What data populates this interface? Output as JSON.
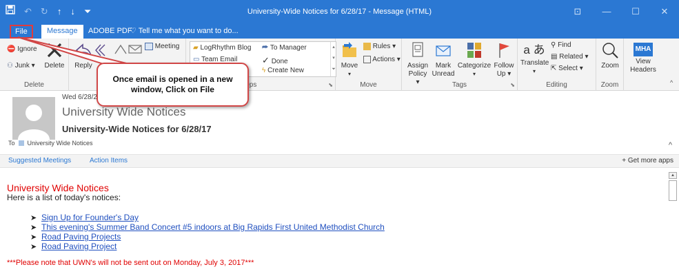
{
  "window": {
    "title": "University-Wide Notices for 6/28/17 - Message (HTML)",
    "qat_icons": [
      "save-icon",
      "undo-icon",
      "redo-icon",
      "up-icon",
      "down-icon",
      "customize-icon"
    ]
  },
  "tabs": {
    "file": "File",
    "message": "Message",
    "adobe": "ADOBE PDF",
    "tell": "Tell me what you want to do..."
  },
  "ribbon": {
    "delete_group": {
      "ignore": "Ignore",
      "delete": "Delete",
      "junk": "Junk",
      "label": "Delete"
    },
    "respond_group": {
      "reply": "Reply",
      "reply_all_partial": "R",
      "meeting": "Meeting"
    },
    "quick_steps": {
      "items": [
        "LogRhythm Blog",
        "Team Email",
        "To Manager",
        "Done",
        "Create New"
      ],
      "label": "ck Steps"
    },
    "move_group": {
      "move": "Move",
      "rules": "Rules",
      "actions": "Actions",
      "label": "Move"
    },
    "tags_group": {
      "assign_line1": "Assign",
      "assign_line2": "Policy",
      "mark_line1": "Mark",
      "mark_line2": "Unread",
      "categorize": "Categorize",
      "follow_line1": "Follow",
      "follow_line2": "Up",
      "label": "Tags"
    },
    "editing_group": {
      "translate": "Translate",
      "find": "Find",
      "related": "Related",
      "select": "Select",
      "label": "Editing"
    },
    "zoom_group": {
      "zoom": "Zoom",
      "label": "Zoom"
    },
    "headers_group": {
      "badge": "MHA",
      "view": "View",
      "headers": "Headers"
    }
  },
  "callout": {
    "text": "Once email is opened in a new window, Click on File"
  },
  "header": {
    "date": "Wed 6/28/20",
    "from": "University Wide Notices",
    "subject": "University-Wide Notices for 6/28/17",
    "to_label": "To",
    "to_value": "University Wide Notices"
  },
  "addins": {
    "suggested": "Suggested Meetings",
    "actions": "Action Items",
    "more_apps": "Get more apps"
  },
  "body": {
    "title": "University Wide Notices",
    "intro": "Here is a list of today's notices:",
    "items": [
      "Sign Up for Founder's Day",
      "This evening's Summer Band Concert #5 indoors at Big Rapids First United Methodist Church",
      "Road Paving Projects",
      "Road Paving Project"
    ],
    "note": "***Please note that UWN's will not be sent out on Monday, July 3, 2017***"
  },
  "colors": {
    "accent": "#2b78d3",
    "callout_border": "#d14646",
    "notice_red": "#e00000",
    "link": "#1f4fbf"
  }
}
